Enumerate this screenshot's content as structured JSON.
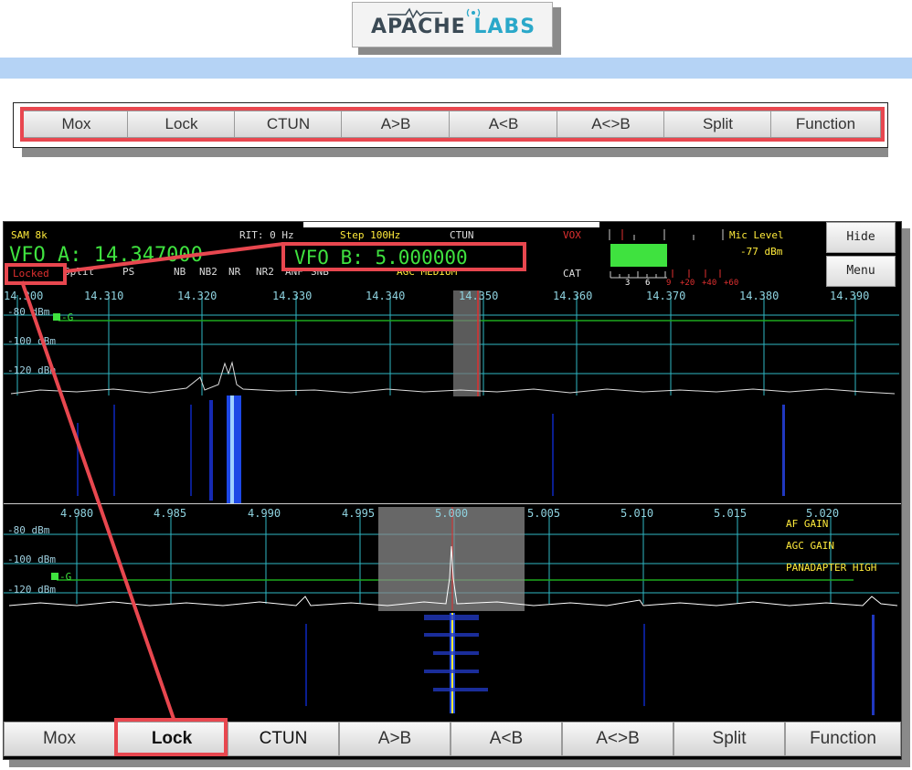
{
  "logo": {
    "part1": "APACHE",
    "part2": "LABS"
  },
  "top_buttons": [
    "Mox",
    "Lock",
    "CTUN",
    "A>B",
    "A<B",
    "A<>B",
    "Split",
    "Function"
  ],
  "status": {
    "mode": "SAM 8k",
    "rit": "RIT: 0 Hz",
    "step": "Step 100Hz",
    "ctun": "CTUN",
    "vox": "VOX",
    "mic_level_label": "Mic Level",
    "mic_level_value": "-77 dBm",
    "cat": "CAT",
    "vfo_a": "VFO A: 14.347000",
    "vfo_b": "VFO B: 5.000000",
    "locked": "Locked",
    "split": "Split",
    "ps": "PS",
    "nb": "NB",
    "nb2": "NB2",
    "nr": "NR",
    "nr2": "NR2",
    "anf": "ANF",
    "snb": "SNB",
    "agc": "AGC MEDIUM"
  },
  "meter": {
    "white_labels": [
      "3",
      "6"
    ],
    "red_labels": [
      "9",
      "+20",
      "+40",
      "+60"
    ]
  },
  "side_buttons": {
    "hide": "Hide",
    "menu": "Menu"
  },
  "panadapter_a": {
    "freq_ticks": [
      "14.300",
      "14.310",
      "14.320",
      "14.330",
      "14.340",
      "14.350",
      "14.360",
      "14.370",
      "14.380",
      "14.390"
    ],
    "db_ticks": [
      "-80 dBm",
      "-100 dBm",
      "-120 dBm"
    ],
    "agc_marker": "-G"
  },
  "panadapter_b": {
    "freq_ticks": [
      "4.980",
      "4.985",
      "4.990",
      "4.995",
      "5.000",
      "5.005",
      "5.010",
      "5.015",
      "5.020"
    ],
    "db_ticks": [
      "-80 dBm",
      "-100 dBm",
      "-120 dBm"
    ],
    "agc_marker": "-G",
    "labels": [
      "AF GAIN",
      "AGC GAIN",
      "PANADAPTER HIGH"
    ]
  },
  "bottom_buttons": [
    "Mox",
    "Lock",
    "CTUN",
    "A>B",
    "A<B",
    "A<>B",
    "Split",
    "Function"
  ],
  "colors": {
    "highlight": "#e8474f",
    "vfo_green": "#3fe23f",
    "grid": "#2fb7c4",
    "label_yellow": "#ffeb3b"
  }
}
